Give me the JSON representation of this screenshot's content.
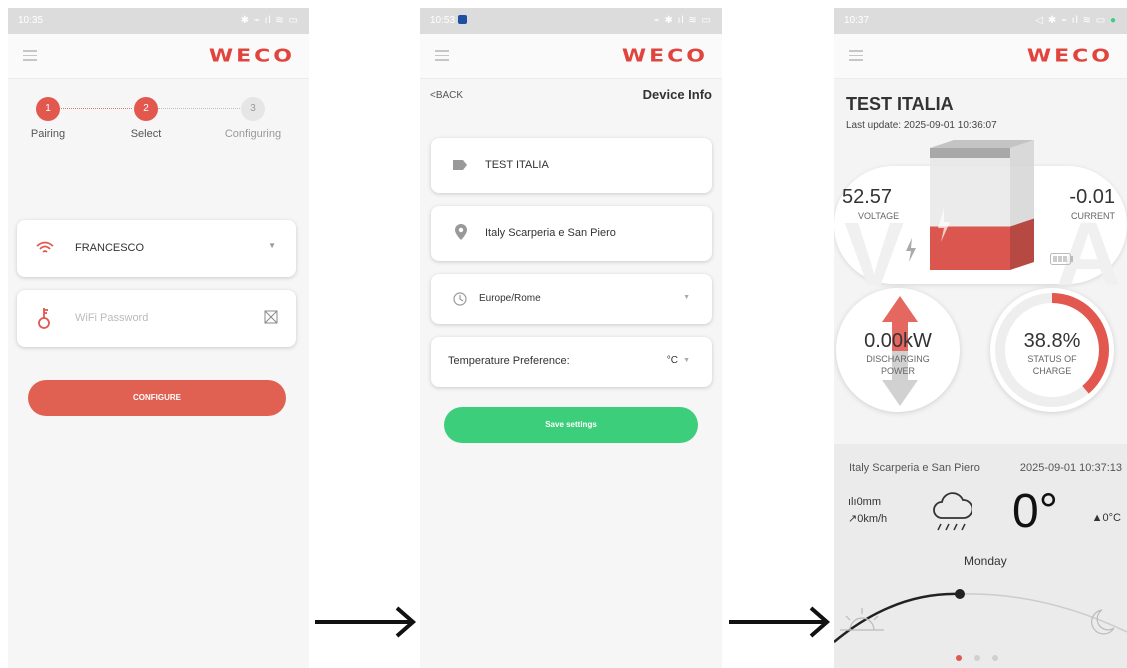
{
  "screen1": {
    "status_time": "10:35",
    "logo": "WECO",
    "steps": [
      {
        "num": "1",
        "label": "Pairing"
      },
      {
        "num": "2",
        "label": "Select"
      },
      {
        "num": "3",
        "label": "Configuring"
      }
    ],
    "wifi_ssid": "FRANCESCO",
    "password_placeholder": "WiFi Password",
    "configure_label": "CONFIGURE",
    "icons": [
      "menu-icon",
      "wifi-icon",
      "dropdown-icon",
      "key-icon",
      "password-visibility-icon"
    ]
  },
  "screen2": {
    "status_time": "10:53",
    "logo": "WECO",
    "back_label": "<BACK",
    "title": "Device Info",
    "device_name": "TEST ITALIA",
    "location": "Italy Scarperia e San Piero",
    "timezone": "Europe/Rome",
    "temp_pref_label": "Temperature Preference:",
    "temp_unit": "°C",
    "save_label": "Save settings",
    "icons": [
      "tag-icon",
      "location-pin-icon",
      "clock-icon",
      "dropdown-icon"
    ]
  },
  "screen3": {
    "status_time": "10:37",
    "logo": "WECO",
    "device_name": "TEST ITALIA",
    "last_update_label": "Last update:",
    "last_update_value": "2025-09-01 10:36:07",
    "voltage_value": "52.57",
    "voltage_label": "VOLTAGE",
    "current_value": "-0.01",
    "current_label": "CURRENT",
    "power_value": "0.00kW",
    "power_label_1": "DISCHARGING",
    "power_label_2": "POWER",
    "soc_value": "38.8%",
    "soc_label_1": "STATUS OF",
    "soc_label_2": "CHARGE",
    "soc_fraction": 0.388,
    "battery_fill_fraction": 0.388,
    "weather_location": "Italy Scarperia e San Piero",
    "weather_time": "2025-09-01 10:37:13",
    "rain": "0mm",
    "wind": "0km/h",
    "temperature": "0°",
    "temp_max": "▲0°C",
    "day": "Monday",
    "page_count": 3,
    "active_page": 1,
    "icons": [
      "battery-icon",
      "lightning-icon",
      "rain-cloud-icon",
      "rain-gauge-icon",
      "wind-icon",
      "sunrise-icon",
      "moon-icon"
    ]
  },
  "colors": {
    "brand": "#e0443d",
    "accent_red": "#e2584f",
    "save_green": "#3dce7b"
  }
}
